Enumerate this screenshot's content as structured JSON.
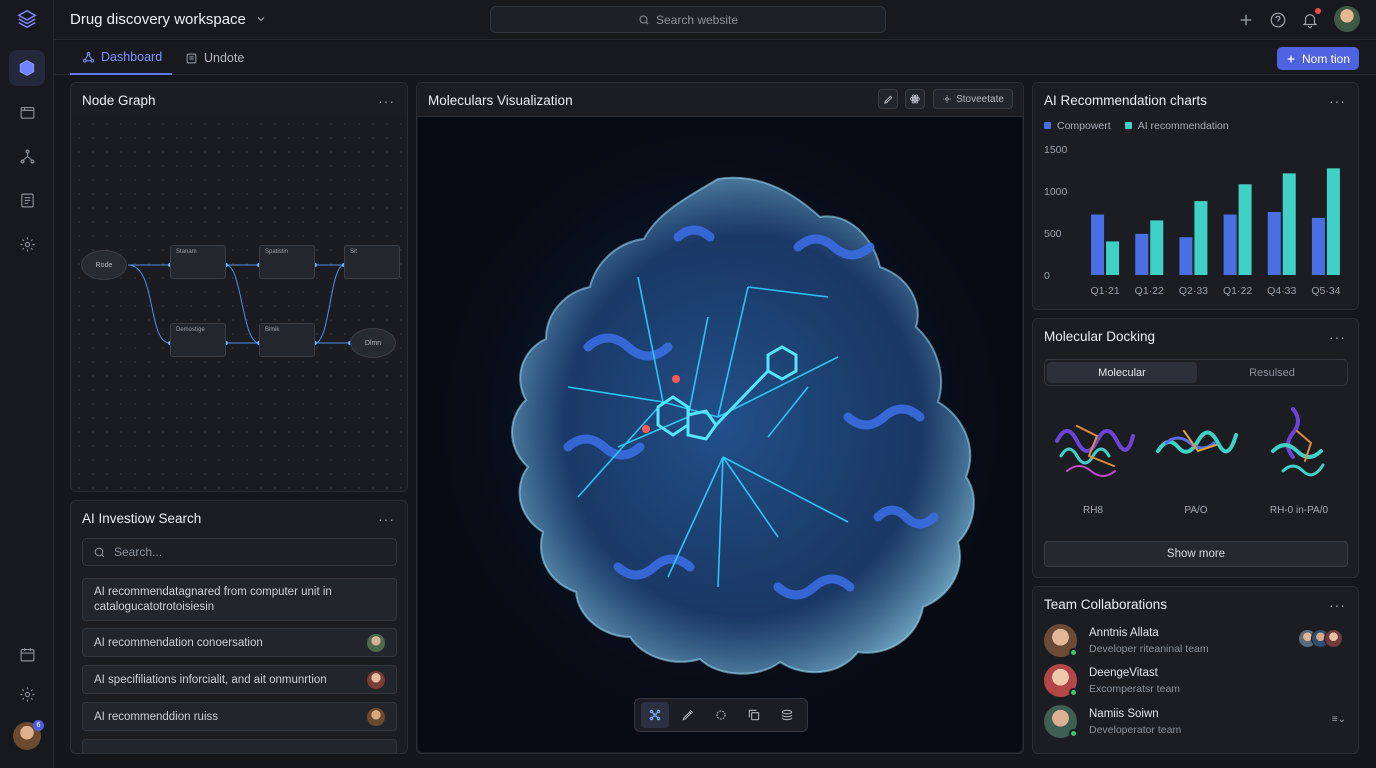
{
  "app": {
    "workspace_title": "Drug discovery workspace",
    "search_placeholder": "Search website",
    "notification_color": "#ef4a4a",
    "accent": "#4f62e0"
  },
  "tabs": [
    {
      "label": "Dashboard",
      "icon": "nodes-icon",
      "active": true
    },
    {
      "label": "Undote",
      "icon": "document-icon",
      "active": false
    }
  ],
  "primary_action": {
    "label": "Nom tion",
    "icon": "plus-icon"
  },
  "rail": {
    "icons": [
      "cube-icon",
      "folder-icon",
      "network-icon",
      "checklist-icon",
      "gear-icon",
      "calendar-icon",
      "gear-icon"
    ],
    "avatar_badge": "6"
  },
  "node_graph": {
    "title": "Node Graph",
    "nodes": [
      "Rode",
      "Stanam",
      "Spatistin",
      "Sit",
      "Demostige",
      "Bilnik",
      "Dlmn"
    ]
  },
  "ai_search": {
    "title": "AI Investiow Search",
    "placeholder": "Search...",
    "results": [
      "AI recommendatagnared from computer unit in catalogucatotrotoisiesin",
      "AI recommendation conoersation",
      "AI specifiliations inforcialit, and ait onmunrtion",
      "AI recommenddion ruiss"
    ]
  },
  "molecular": {
    "title": "Moleculars Visualization",
    "toolbar_pill": "Stoveetate",
    "header_tools": [
      "pencil-icon",
      "atom-icon",
      "gear-icon"
    ],
    "viewer_tools": [
      "molecule-icon",
      "eyedropper-icon",
      "rotate-icon",
      "copy-icon",
      "layers-icon"
    ]
  },
  "recommendation_chart": {
    "title": "AI Recommendation charts",
    "legend": [
      "Compowert",
      "AI recommendation"
    ],
    "colors": [
      "#4a6fe3",
      "#3fd1c5"
    ],
    "tick_labels": [
      "1500",
      "1000",
      "500",
      "0"
    ]
  },
  "chart_data": {
    "type": "bar",
    "title": "AI Recommendation charts",
    "categories": [
      "Q1·21",
      "Q1·22",
      "Q2·33",
      "Q1·22",
      "Q4·33",
      "Q5·34"
    ],
    "series": [
      {
        "name": "Compowert",
        "values": [
          720,
          490,
          450,
          720,
          750,
          680
        ]
      },
      {
        "name": "AI recommendation",
        "values": [
          400,
          650,
          880,
          1080,
          1210,
          1270
        ]
      }
    ],
    "ylim": [
      0,
      1500
    ],
    "yticks": [
      0,
      500,
      1000,
      1500
    ],
    "grid": false,
    "legend": "top-left"
  },
  "docking": {
    "title": "Molecular Docking",
    "segments": [
      "Molecular",
      "Resulsed"
    ],
    "labels": [
      "RH8",
      "PA/O",
      "RH-0 in-PA/0"
    ],
    "show_more": "Show more"
  },
  "team": {
    "title": "Team Collaborations",
    "members": [
      {
        "name": "Anntnis Allata",
        "team": "Developer riteaninal team"
      },
      {
        "name": "DeengeVitast",
        "team": "Excomperatsr team"
      },
      {
        "name": "Namiis Soiwn",
        "team": "Developerator team"
      }
    ],
    "row_action": "≡⌄"
  }
}
